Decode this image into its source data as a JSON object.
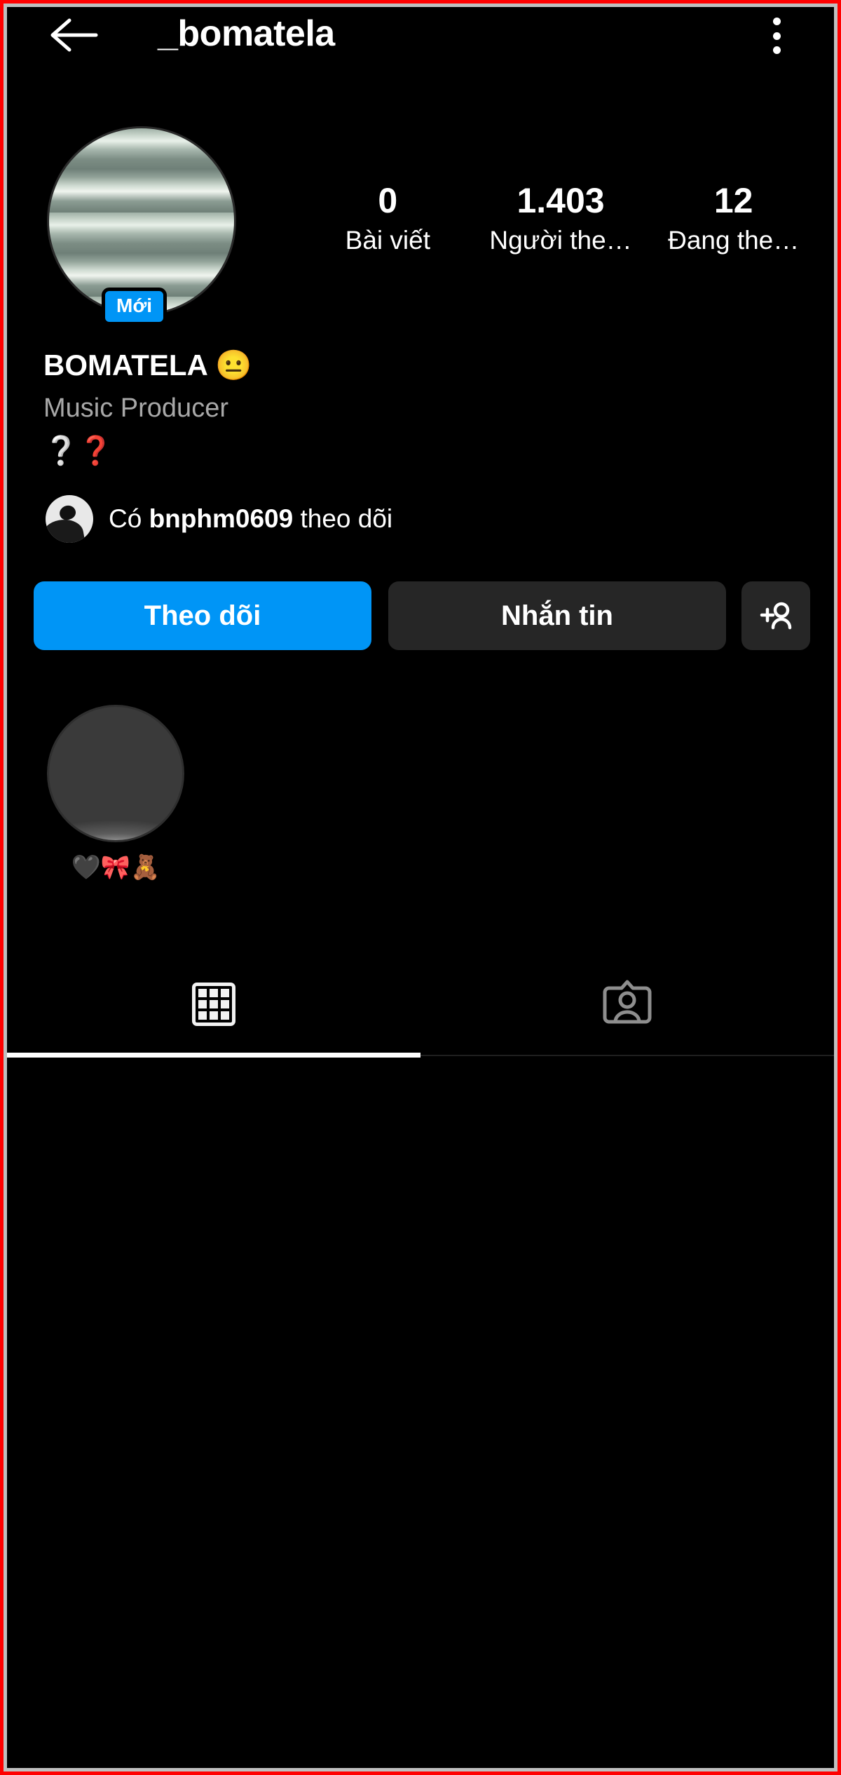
{
  "theme": {
    "background": "#000000",
    "accent_blue": "#0095f6",
    "button_dark": "#262626",
    "text_primary": "#ffffff",
    "text_secondary": "#a8a8a8",
    "frame_border": "#ff0000"
  },
  "topbar": {
    "back_icon": "arrow-left-icon",
    "title": "_bomatela",
    "menu_icon": "kebab-menu-icon"
  },
  "profile": {
    "avatar_alt": "profile-picture",
    "new_badge": "Mới",
    "display_name": "BOMATELA 😐",
    "category": "Music Producer",
    "bio": "❔❓"
  },
  "stats": [
    {
      "value": "0",
      "label": "Bài viết",
      "name": "posts"
    },
    {
      "value": "1.403",
      "label": "Người the…",
      "name": "followers"
    },
    {
      "value": "12",
      "label": "Đang the…",
      "name": "following"
    }
  ],
  "followed_by": {
    "prefix": "Có ",
    "username": "bnphm0609",
    "suffix": " theo dõi"
  },
  "actions": {
    "follow": "Theo dõi",
    "message": "Nhắn tin",
    "add_person_icon": "person-add-icon"
  },
  "highlights": [
    {
      "label": "🖤🎀🧸"
    }
  ],
  "tabs": [
    {
      "name": "grid",
      "icon": "grid-icon",
      "active": true
    },
    {
      "name": "tagged",
      "icon": "tagged-icon",
      "active": false
    }
  ]
}
